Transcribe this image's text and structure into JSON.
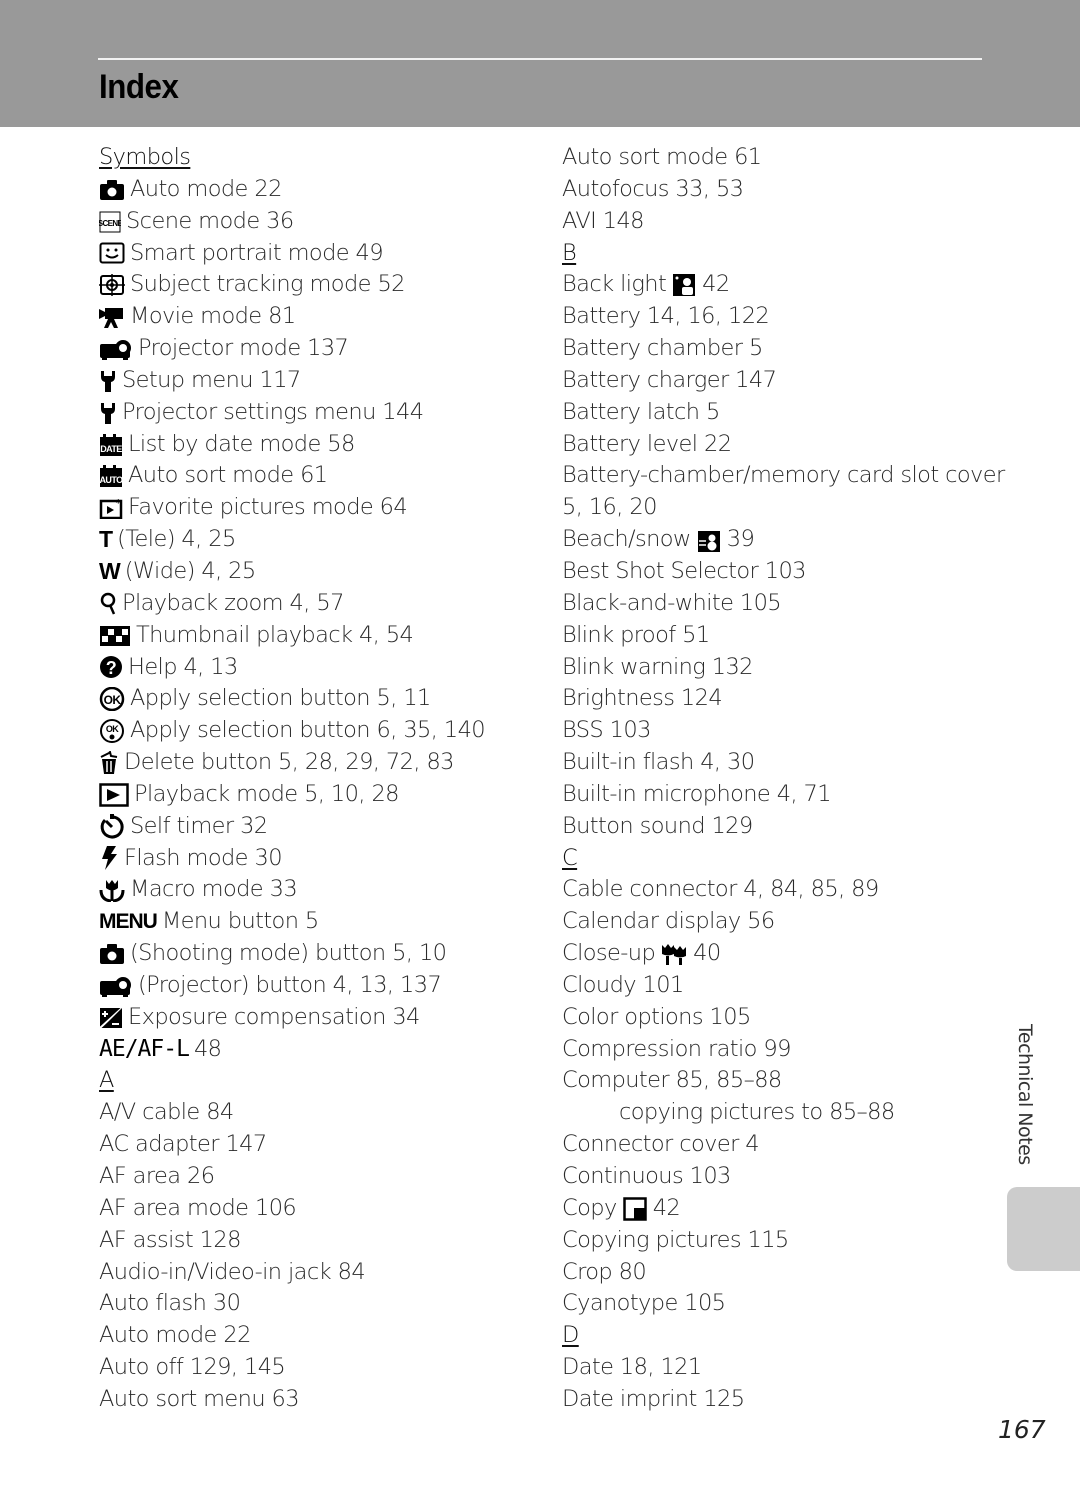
{
  "header": {
    "title": "Index"
  },
  "left_column": [
    {
      "type": "heading",
      "text": "Symbols"
    },
    {
      "type": "entry",
      "icon": "camera-icon",
      "text": "Auto mode 22"
    },
    {
      "type": "entry",
      "icon": "scene-icon",
      "text": "Scene mode 36"
    },
    {
      "type": "entry",
      "icon": "smart-portrait-icon",
      "text": "Smart portrait mode 49"
    },
    {
      "type": "entry",
      "icon": "subject-tracking-icon",
      "text": "Subject tracking mode 52"
    },
    {
      "type": "entry",
      "icon": "movie-camera-icon",
      "text": "Movie mode 81"
    },
    {
      "type": "entry",
      "icon": "projector-icon",
      "text": "Projector mode 137"
    },
    {
      "type": "entry",
      "icon": "wrench-icon",
      "text": "Setup menu 117"
    },
    {
      "type": "entry",
      "icon": "wrench-icon",
      "text": "Projector settings menu 144"
    },
    {
      "type": "entry",
      "icon": "list-by-date-icon",
      "text": "List by date mode 58"
    },
    {
      "type": "entry",
      "icon": "auto-sort-icon",
      "text": "Auto sort mode 61"
    },
    {
      "type": "entry",
      "icon": "favorite-pictures-icon",
      "text": "Favorite pictures mode 64"
    },
    {
      "type": "entry",
      "icon": "tele-icon",
      "icon_text": "T",
      "text": "(Tele) 4, 25"
    },
    {
      "type": "entry",
      "icon": "wide-icon",
      "icon_text": "W",
      "text": "(Wide) 4, 25"
    },
    {
      "type": "entry",
      "icon": "playback-zoom-icon",
      "text": "Playback zoom 4, 57"
    },
    {
      "type": "entry",
      "icon": "thumbnail-icon",
      "text": "Thumbnail playback 4, 54"
    },
    {
      "type": "entry",
      "icon": "help-icon",
      "text": "Help 4, 13"
    },
    {
      "type": "entry",
      "icon": "ok-button-icon",
      "text": "Apply selection button 5, 11"
    },
    {
      "type": "entry",
      "icon": "ok-rotary-icon",
      "text": "Apply selection button 6, 35, 140"
    },
    {
      "type": "entry",
      "icon": "delete-icon",
      "text": "Delete button 5, 28, 29, 72, 83"
    },
    {
      "type": "entry",
      "icon": "playback-icon",
      "text": "Playback mode 5, 10, 28"
    },
    {
      "type": "entry",
      "icon": "self-timer-icon",
      "text": "Self timer 32"
    },
    {
      "type": "entry",
      "icon": "flash-icon",
      "text": "Flash mode 30"
    },
    {
      "type": "entry",
      "icon": "macro-icon",
      "text": "Macro mode 33"
    },
    {
      "type": "entry",
      "icon": "menu-icon",
      "icon_text": "MENU",
      "text": "Menu button 5"
    },
    {
      "type": "entry",
      "icon": "camera-icon",
      "text": "(Shooting mode) button 5, 10"
    },
    {
      "type": "entry",
      "icon": "projector-icon",
      "text": "(Projector) button 4, 13, 137"
    },
    {
      "type": "entry",
      "icon": "exposure-compensation-icon",
      "text": "Exposure compensation 34"
    },
    {
      "type": "entry",
      "icon": "ae-af-lock-icon",
      "icon_text": "AE/AF-L",
      "text": "48"
    },
    {
      "type": "heading",
      "text": "A"
    },
    {
      "type": "entry",
      "text": "A/V cable 84"
    },
    {
      "type": "entry",
      "text": "AC adapter 147"
    },
    {
      "type": "entry",
      "text": "AF area 26"
    },
    {
      "type": "entry",
      "text": "AF area mode 106"
    },
    {
      "type": "entry",
      "text": "AF assist 128"
    },
    {
      "type": "entry",
      "text": "Audio-in/Video-in jack 84"
    },
    {
      "type": "entry",
      "text": "Auto flash 30"
    },
    {
      "type": "entry",
      "text": "Auto mode 22"
    },
    {
      "type": "entry",
      "text": "Auto off 129, 145"
    },
    {
      "type": "entry",
      "text": "Auto sort menu 63"
    }
  ],
  "right_column": [
    {
      "type": "entry",
      "text": "Auto sort mode 61"
    },
    {
      "type": "entry",
      "text": "Autofocus 33, 53"
    },
    {
      "type": "entry",
      "text": "AVI 148"
    },
    {
      "type": "heading",
      "text": "B"
    },
    {
      "type": "entry",
      "text": "Back light",
      "inline_icon": "back-light-icon",
      "pages": "42"
    },
    {
      "type": "entry",
      "text": "Battery 14, 16, 122"
    },
    {
      "type": "entry",
      "text": "Battery chamber 5"
    },
    {
      "type": "entry",
      "text": "Battery charger 147"
    },
    {
      "type": "entry",
      "text": "Battery latch 5"
    },
    {
      "type": "entry",
      "text": "Battery level 22"
    },
    {
      "type": "entry",
      "text": "Battery-chamber/memory card slot cover"
    },
    {
      "type": "entry",
      "text": "5, 16, 20"
    },
    {
      "type": "entry",
      "text": "Beach/snow",
      "inline_icon": "beach-snow-icon",
      "pages": "39"
    },
    {
      "type": "entry",
      "text": "Best Shot Selector 103"
    },
    {
      "type": "entry",
      "text": "Black-and-white 105"
    },
    {
      "type": "entry",
      "text": "Blink proof 51"
    },
    {
      "type": "entry",
      "text": "Blink warning 132"
    },
    {
      "type": "entry",
      "text": "Brightness 124"
    },
    {
      "type": "entry",
      "text": "BSS 103"
    },
    {
      "type": "entry",
      "text": "Built-in flash 4, 30"
    },
    {
      "type": "entry",
      "text": "Built-in microphone 4, 71"
    },
    {
      "type": "entry",
      "text": "Button sound 129"
    },
    {
      "type": "heading",
      "text": "C"
    },
    {
      "type": "entry",
      "text": "Cable connector 4, 84, 85, 89"
    },
    {
      "type": "entry",
      "text": "Calendar display 56"
    },
    {
      "type": "entry",
      "text": "Close-up",
      "inline_icon": "close-up-icon",
      "pages": "40"
    },
    {
      "type": "entry",
      "text": "Cloudy 101"
    },
    {
      "type": "entry",
      "text": "Color options 105"
    },
    {
      "type": "entry",
      "text": "Compression ratio 99"
    },
    {
      "type": "entry",
      "text": "Computer 85, 85–88"
    },
    {
      "type": "subentry",
      "text": "copying pictures to 85–88"
    },
    {
      "type": "entry",
      "text": "Connector cover 4"
    },
    {
      "type": "entry",
      "text": "Continuous 103"
    },
    {
      "type": "entry",
      "text": "Copy",
      "inline_icon": "copy-icon",
      "pages": "42"
    },
    {
      "type": "entry",
      "text": "Copying pictures 115"
    },
    {
      "type": "entry",
      "text": "Crop 80"
    },
    {
      "type": "entry",
      "text": "Cyanotype 105"
    },
    {
      "type": "heading",
      "text": "D"
    },
    {
      "type": "entry",
      "text": "Date 18, 121"
    },
    {
      "type": "entry",
      "text": "Date imprint 125"
    }
  ],
  "side_tab": {
    "label": "Technical Notes"
  },
  "footer": {
    "page_number": "167"
  },
  "colors": {
    "header_bg": "#999999",
    "side_tab_bg": "#cccccc"
  }
}
